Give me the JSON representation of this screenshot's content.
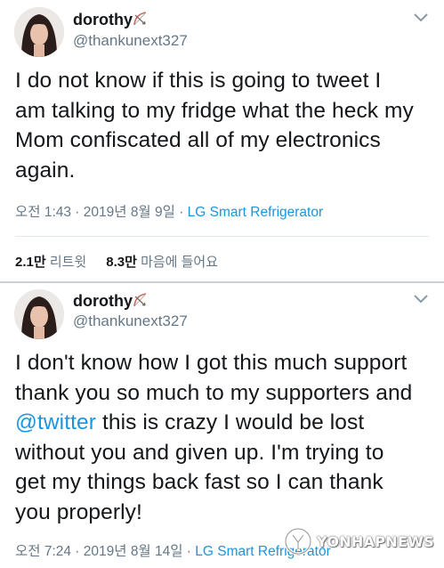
{
  "tweets": [
    {
      "display_name": "dorothy",
      "handle": "@thankunext327",
      "text_lines": [
        "I do not know if this is going to tweet I",
        "am talking to my fridge what the heck my",
        "Mom confiscated all of my electronics",
        "again."
      ],
      "timestamp": "오전 1:43 · 2019년 8월 9일 · ",
      "source": "LG Smart Refrigerator",
      "retweets_count": "2.1만",
      "retweets_label": "리트윗",
      "likes_count": "8.3만",
      "likes_label": "마음에 들어요"
    },
    {
      "display_name": "dorothy",
      "handle": "@thankunext327",
      "text_lines": [
        "I don't know how I got this much support",
        "thank you so much to my supporters and",
        "this is crazy I would be lost",
        "without you and given up. I'm trying to",
        "get my things back fast so I can thank",
        "you properly!"
      ],
      "mention": "@twitter",
      "timestamp": "오전 7:24 · 2019년 8월 14일 · ",
      "source": "LG Smart Refrigerator"
    }
  ],
  "watermark": "YONHAPNEWS",
  "icons": {
    "name_badge": "bow-and-arrow-icon",
    "menu": "chevron-down-icon"
  },
  "colors": {
    "link": "#1b95e0",
    "muted": "#657786",
    "text": "#14171a"
  }
}
